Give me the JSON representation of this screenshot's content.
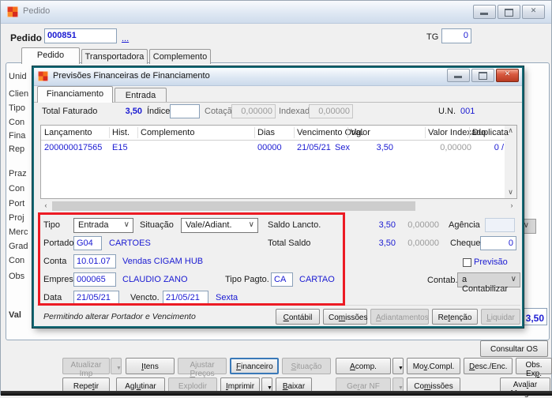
{
  "window": {
    "title": "Pedido",
    "controls": [
      "minimize-icon",
      "maximize-icon",
      "close-icon"
    ]
  },
  "order": {
    "label": "Pedido",
    "number": "000851",
    "lookup_link": "...",
    "tg_label": "TG",
    "tg_value": "0",
    "bottom_field_label": "Val",
    "bottom_total": "3,50"
  },
  "tabs": [
    "Pedido",
    "Transportadora",
    "Complemento"
  ],
  "sidebar_labels": [
    "Unid",
    "Clien",
    "Tipo",
    "Con",
    "Fina",
    "Rep",
    "Praz",
    "Con",
    "Port",
    "Proj",
    "Merc",
    "Grad",
    "Con",
    "Obs"
  ],
  "modal": {
    "title": "Previsões Financeiras de Financiamento",
    "controls": [
      "minimize-icon",
      "maximize-icon",
      "close-icon"
    ],
    "tabs": [
      "Financiamento",
      "Entrada"
    ],
    "totals": {
      "total_faturado_label": "Total Faturado",
      "total_faturado": "3,50",
      "indice_label": "Índice",
      "indice": "",
      "cotacao_label": "Cotação",
      "cotacao": "0,00000",
      "indexado_label": "Indexado",
      "indexado": "0,00000",
      "un_label": "U.N.",
      "un": "001"
    },
    "table": {
      "columns": [
        "Lançamento",
        "Hist.",
        "Complemento",
        "Dias",
        "Vencimento Orig.",
        "Valor",
        "Valor Indexado",
        "Duplicata"
      ],
      "rows": [
        {
          "lancamento": "200000017565",
          "hist": "E15",
          "complemento": "",
          "dias": "00000",
          "vencimento": "21/05/21",
          "dia_semana": "Sex",
          "valor": "3,50",
          "valor_indexado": "0,00000",
          "duplicata": "0 /"
        }
      ]
    },
    "form": {
      "tipo_label": "Tipo",
      "tipo": "Entrada",
      "situacao_label": "Situação",
      "situacao": "Vale/Adiant.",
      "saldo_lancto_label": "Saldo Lancto.",
      "saldo_lancto": "3,50",
      "saldo_lancto_idx": "0,00000",
      "agencia_label": "Agência",
      "agencia": "",
      "portador_label": "Portador",
      "portador": "G04",
      "portador_desc": "CARTOES",
      "total_saldo_label": "Total Saldo",
      "total_saldo": "3,50",
      "total_saldo_idx": "0,00000",
      "cheque_label": "Cheque",
      "cheque": "0",
      "conta_label": "Conta",
      "conta": "10.01.07",
      "conta_desc": "Vendas CIGAM HUB",
      "previsao_label": "Previsão",
      "empresa_label": "Empresa",
      "empresa": "000065",
      "empresa_desc": "CLAUDIO ZANO",
      "tipo_pagto_label": "Tipo Pagto.",
      "tipo_pagto": "CA",
      "tipo_pagto_desc": "CARTAO",
      "contab_label": "Contab.",
      "contab": "a Contabilizar",
      "data_label": "Data",
      "data": "21/05/21",
      "vencto_label": "Vencto.",
      "vencto": "21/05/21",
      "vencto_dia": "Sexta"
    },
    "status_note": "Permitindo alterar Portador e Vencimento",
    "buttons": [
      {
        "label": "Contábil",
        "ul": 0,
        "disabled": false
      },
      {
        "label": "Comissões",
        "ul": 2,
        "disabled": false
      },
      {
        "label": "Adiantamentos",
        "ul": 0,
        "disabled": true
      },
      {
        "label": "Retenção",
        "ul": 2,
        "disabled": false
      },
      {
        "label": "Liquidar",
        "ul": 0,
        "disabled": true
      }
    ]
  },
  "colors": {
    "accent_blue": "#1a1ad2",
    "annotation_red": "#ec1b24",
    "disabled_gray": "#9b9b9b"
  },
  "actions": {
    "consultar_os": "Consultar OS",
    "row1": [
      {
        "label": "Atualizar Imp",
        "disabled": true,
        "dropdown": true
      },
      {
        "label": "Itens",
        "ul": 0
      },
      {
        "label": "Ajustar Preços",
        "ul": 8,
        "disabled": true
      },
      {
        "label": "Financeiro",
        "ul": 0,
        "focused": true
      },
      {
        "label": "Situação",
        "ul": 0,
        "disabled": true
      },
      {
        "label": "Acomp.",
        "ul": 0,
        "dropdown": true
      },
      {
        "label": "Mov.Compl.",
        "ul": 2
      },
      {
        "label": "Desc./Enc.",
        "ul": 0
      },
      {
        "label": "Obs. Exp.",
        "ul": 7
      }
    ],
    "row2": [
      {
        "label": "Repetir",
        "ul": 4
      },
      {
        "label": "Aglutinar",
        "ul": 3
      },
      {
        "label": "Explodir",
        "disabled": true
      },
      {
        "label": "Imprimir",
        "ul": 0,
        "dropdown": true
      },
      {
        "label": "Baixar",
        "ul": 0
      },
      {
        "label": "Gerar NF",
        "ul": 2,
        "disabled": true,
        "dropdown": true
      },
      {
        "label": "Comissões",
        "ul": 2
      },
      {
        "label": "Avaliar Margem",
        "ul": 3
      }
    ]
  }
}
